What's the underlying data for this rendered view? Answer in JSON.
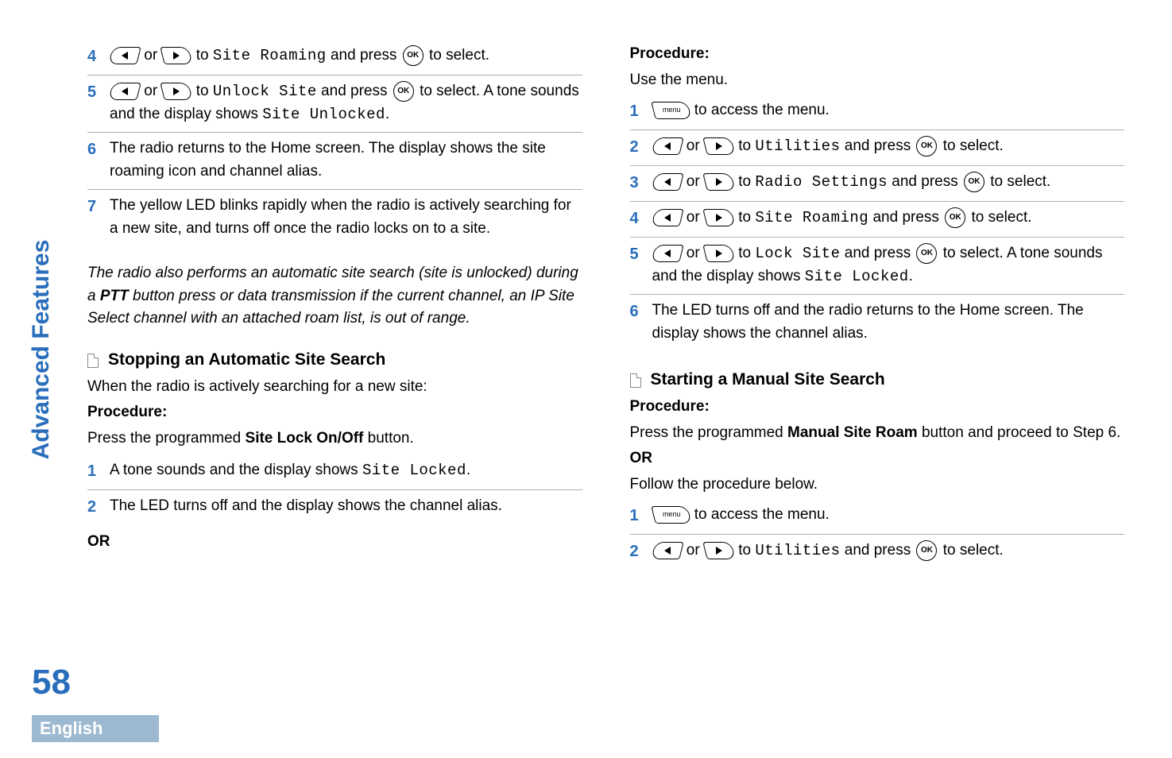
{
  "sidebar": {
    "section": "Advanced Features",
    "page_number": "58",
    "language": "English"
  },
  "icons": {
    "ok": "OK",
    "menu": "menu"
  },
  "left_col": {
    "step4": {
      "n": "4",
      "to": " to ",
      "target": "Site Roaming",
      "and": " and press ",
      "sel": " to select."
    },
    "step5": {
      "n": "5",
      "to": " to ",
      "target": "Unlock Site",
      "and": " and press ",
      "sel": " to select. A tone sounds and the display shows ",
      "result": "Site Unlocked",
      "period": "."
    },
    "step6": {
      "n": "6",
      "text": "The radio returns to the Home screen. The display shows the site roaming icon and channel alias."
    },
    "step7": {
      "n": "7",
      "text": "The yellow LED blinks rapidly when the radio is actively searching for a new site, and turns off once the radio locks on to a site."
    },
    "italic": {
      "p1": "The radio also performs an automatic site search (site is unlocked) during a ",
      "ptt": "PTT",
      "p2": " button press or data transmission if the current channel, an IP Site Select channel with an attached roam list, is out of range."
    },
    "h1": "Stopping an Automatic Site Search",
    "intro1": "When the radio is actively searching for a new site:",
    "proc_label": "Procedure:",
    "proc1_pre": "Press the programmed ",
    "proc1_btn": "Site Lock On/Off",
    "proc1_post": " button.",
    "s1": {
      "n": "1",
      "pre": "A tone sounds and the display shows ",
      "mono": "Site Locked",
      "post": "."
    },
    "s2": {
      "n": "2",
      "text": "The LED turns off and the display shows the channel alias."
    },
    "or": "OR"
  },
  "right_col": {
    "proc_label": "Procedure:",
    "use_menu": "Use the menu.",
    "r1": {
      "n": "1",
      "text": " to access the menu."
    },
    "r2": {
      "n": "2",
      "to": " to ",
      "target": "Utilities",
      "and": " and press ",
      "sel": " to select."
    },
    "r3": {
      "n": "3",
      "to": " to ",
      "target": "Radio Settings",
      "and": " and press ",
      "sel": " to select."
    },
    "r4": {
      "n": "4",
      "to": " to ",
      "target": "Site Roaming",
      "and": " and press ",
      "sel": " to select."
    },
    "r5": {
      "n": "5",
      "to": " to ",
      "target": "Lock Site",
      "and": " and press ",
      "sel": " to select. A tone sounds and the display shows ",
      "result": "Site Locked",
      "period": "."
    },
    "r6": {
      "n": "6",
      "text": "The LED turns off and the radio returns to the Home screen. The display shows the channel alias."
    },
    "h2": "Starting a Manual Site Search",
    "proc2_label": "Procedure:",
    "proc2_pre": "Press the programmed ",
    "proc2_btn": "Manual Site Roam",
    "proc2_post": " button and proceed to Step 6.",
    "or": "OR",
    "follow": "Follow the procedure below.",
    "b1": {
      "n": "1",
      "text": " to access the menu."
    },
    "b2": {
      "n": "2",
      "to": " to ",
      "target": "Utilities",
      "and": " and press ",
      "sel": " to select."
    }
  }
}
